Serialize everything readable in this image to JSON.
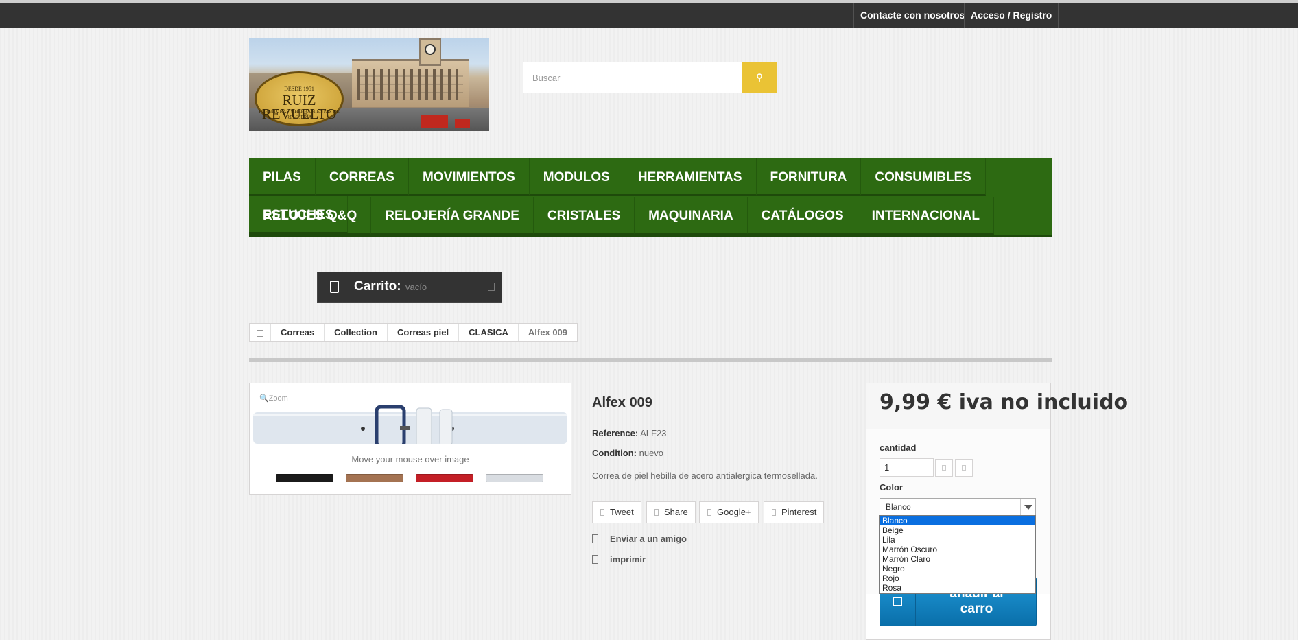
{
  "topbar": {
    "contact": "Contacte con nosotros",
    "login": "Acceso / Registro"
  },
  "logo": {
    "since": "DESDE 1951",
    "name_line1": "RUIZ",
    "name_line2": "REVUELTO",
    "tagline": "FORNITURAS Y HERRAMIENTAS DE RELOJERÍA"
  },
  "search": {
    "placeholder": "Buscar"
  },
  "menu": {
    "row1": [
      "PILAS",
      "CORREAS",
      "MOVIMIENTOS",
      "MODULOS",
      "HERRAMIENTAS",
      "FORNITURA",
      "CONSUMIBLES",
      "ESTUCHES"
    ],
    "row2": [
      "RELOJES Q&Q",
      "RELOJERÍA GRANDE",
      "CRISTALES",
      "MAQUINARIA",
      "CATÁLOGOS",
      "INTERNACIONAL"
    ]
  },
  "cart": {
    "label": "Carrito:",
    "status": "vacío"
  },
  "breadcrumb": {
    "items": [
      "Correas",
      "Collection",
      "Correas piel",
      "CLASICA"
    ],
    "current": "Alfex 009"
  },
  "gallery": {
    "zoom": "Zoom",
    "hint": "Move your mouse over image",
    "thumbs": [
      "#1b1b1b",
      "#a47352",
      "#c41f26",
      "#d9dde2"
    ]
  },
  "product": {
    "title": "Alfex 009",
    "reference_label": "Reference:",
    "reference": "ALF23",
    "condition_label": "Condition:",
    "condition": "nuevo",
    "description": "Correa de piel hebilla de acero antialergica termosellada."
  },
  "social": [
    "Tweet",
    "Share",
    "Google+",
    "Pinterest"
  ],
  "actions": {
    "send": "Enviar a un amigo",
    "print": "imprimir"
  },
  "buy": {
    "price": "9,99 € iva no incluido",
    "qty_label": "cantidad",
    "qty": "1",
    "color_label": "Color",
    "color_selected": "Blanco",
    "color_options": [
      "Blanco",
      "Beige",
      "Lila",
      "Marrón Oscuro",
      "Marrón Claro",
      "Negro",
      "Rojo",
      "Rosa"
    ],
    "add_line1": "añadir al",
    "add_line2": "carro"
  }
}
